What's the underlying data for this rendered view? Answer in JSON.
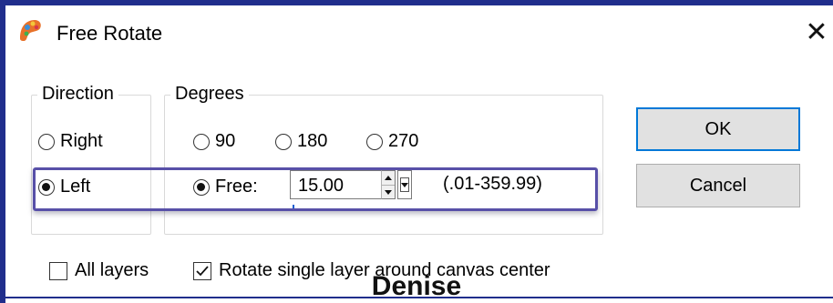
{
  "window": {
    "title": "Free Rotate",
    "close_symbol": "✕",
    "frame_color": "#202e8c"
  },
  "direction": {
    "group_label": "Direction",
    "options": [
      {
        "label": "Right",
        "checked": false
      },
      {
        "label": "Left",
        "checked": true
      }
    ]
  },
  "degrees": {
    "group_label": "Degrees",
    "options": [
      {
        "label": "90",
        "checked": false
      },
      {
        "label": "180",
        "checked": false
      },
      {
        "label": "270",
        "checked": false
      },
      {
        "label": "Free:",
        "checked": true
      }
    ],
    "free_value": "15.00",
    "range_text": "(.01-359.99)"
  },
  "buttons": {
    "ok": "OK",
    "cancel": "Cancel"
  },
  "options": {
    "all_layers": {
      "label": "All layers",
      "checked": false
    },
    "rotate_single": {
      "label": "Rotate single layer around canvas center",
      "checked": true
    }
  },
  "watermark": "Denise",
  "colors": {
    "highlight": "#5850a8",
    "ok_border": "#0078d7"
  }
}
